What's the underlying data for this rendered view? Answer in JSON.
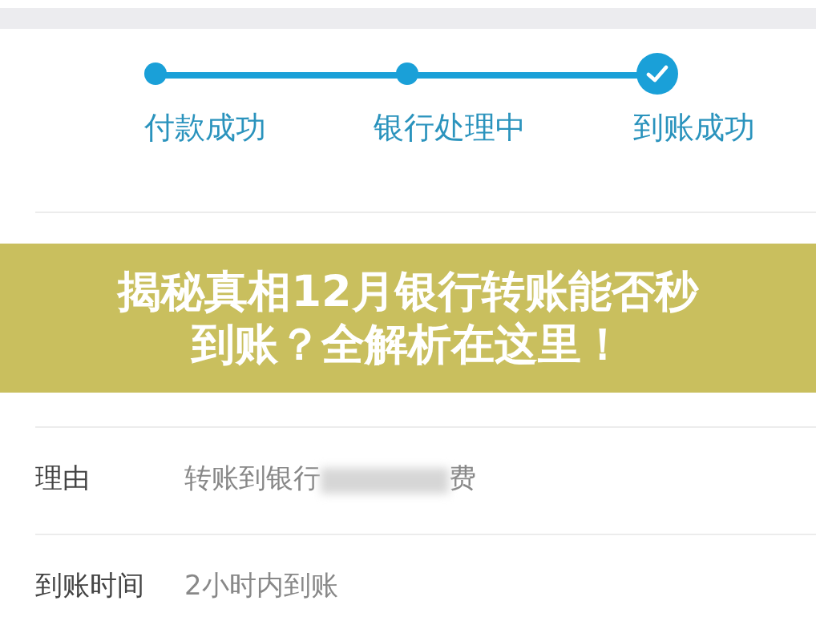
{
  "steps": [
    {
      "label": "付款成功",
      "kind": "dot"
    },
    {
      "label": "银行处理中",
      "kind": "dot"
    },
    {
      "label": "到账成功",
      "kind": "check"
    }
  ],
  "rows": [
    {
      "label": "理由",
      "value": "转账到银行",
      "value_end": "费",
      "redacted": true
    },
    {
      "label": "到账时间",
      "value": "2小时内到账"
    }
  ],
  "banner": {
    "title": "揭秘真相12月银行转账能否秒到账？全解析在这里！"
  }
}
